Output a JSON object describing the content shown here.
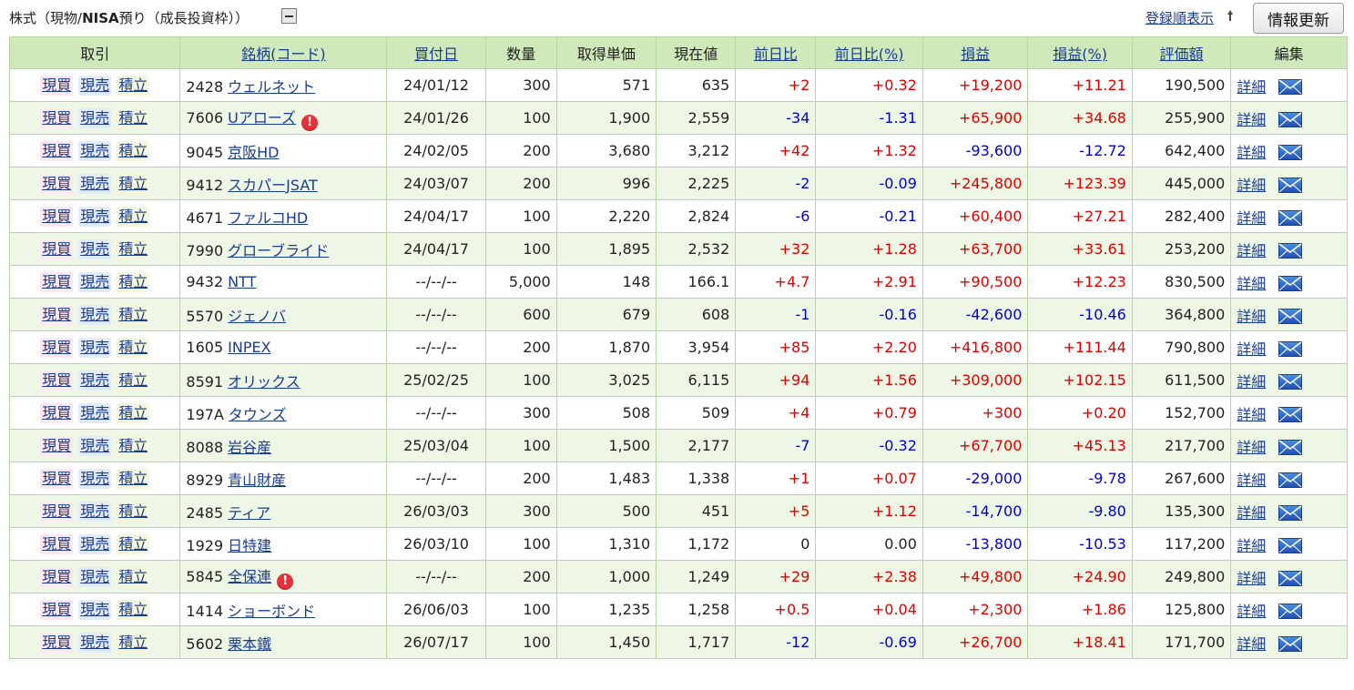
{
  "header": {
    "title_prefix": "株式（現物/",
    "title_bold": "NISA",
    "title_suffix": "預り（成長投資枠））",
    "sort_link": "登録順表示",
    "refresh_button": "情報更新"
  },
  "table": {
    "headers": {
      "trade": "取引",
      "name": "銘柄(コード)",
      "buy_date": "買付日",
      "quantity": "数量",
      "avg_price": "取得単価",
      "current_price": "現在値",
      "change": "前日比",
      "change_pct": "前日比(%)",
      "pl": "損益",
      "pl_pct": "損益(%)",
      "valuation": "評価額",
      "edit": "編集"
    },
    "trade_labels": {
      "buy": "現買",
      "sell": "現売",
      "accum": "積立"
    },
    "detail_label": "詳細",
    "alert_glyph": "!",
    "rows": [
      {
        "code": "2428",
        "name": "ウェルネット",
        "alert": false,
        "date": "24/01/12",
        "qty": "300",
        "avg": "571",
        "price": "635",
        "chg": "+2",
        "chg_pct": "+0.32",
        "pl": "+19,200",
        "pl_pct": "+11.21",
        "val": "190,500"
      },
      {
        "code": "7606",
        "name": "Uアローズ",
        "alert": true,
        "date": "24/01/26",
        "qty": "100",
        "avg": "1,900",
        "price": "2,559",
        "chg": "-34",
        "chg_pct": "-1.31",
        "pl": "+65,900",
        "pl_pct": "+34.68",
        "val": "255,900"
      },
      {
        "code": "9045",
        "name": "京阪HD",
        "alert": false,
        "date": "24/02/05",
        "qty": "200",
        "avg": "3,680",
        "price": "3,212",
        "chg": "+42",
        "chg_pct": "+1.32",
        "pl": "-93,600",
        "pl_pct": "-12.72",
        "val": "642,400"
      },
      {
        "code": "9412",
        "name": "スカパーJSAT",
        "alert": false,
        "date": "24/03/07",
        "qty": "200",
        "avg": "996",
        "price": "2,225",
        "chg": "-2",
        "chg_pct": "-0.09",
        "pl": "+245,800",
        "pl_pct": "+123.39",
        "val": "445,000"
      },
      {
        "code": "4671",
        "name": "ファルコHD",
        "alert": false,
        "date": "24/04/17",
        "qty": "100",
        "avg": "2,220",
        "price": "2,824",
        "chg": "-6",
        "chg_pct": "-0.21",
        "pl": "+60,400",
        "pl_pct": "+27.21",
        "val": "282,400"
      },
      {
        "code": "7990",
        "name": "グローブライド",
        "alert": false,
        "date": "24/04/17",
        "qty": "100",
        "avg": "1,895",
        "price": "2,532",
        "chg": "+32",
        "chg_pct": "+1.28",
        "pl": "+63,700",
        "pl_pct": "+33.61",
        "val": "253,200"
      },
      {
        "code": "9432",
        "name": "NTT",
        "alert": false,
        "date": "--/--/--",
        "qty": "5,000",
        "avg": "148",
        "price": "166.1",
        "chg": "+4.7",
        "chg_pct": "+2.91",
        "pl": "+90,500",
        "pl_pct": "+12.23",
        "val": "830,500"
      },
      {
        "code": "5570",
        "name": "ジェノバ",
        "alert": false,
        "date": "--/--/--",
        "qty": "600",
        "avg": "679",
        "price": "608",
        "chg": "-1",
        "chg_pct": "-0.16",
        "pl": "-42,600",
        "pl_pct": "-10.46",
        "val": "364,800"
      },
      {
        "code": "1605",
        "name": "INPEX",
        "alert": false,
        "date": "--/--/--",
        "qty": "200",
        "avg": "1,870",
        "price": "3,954",
        "chg": "+85",
        "chg_pct": "+2.20",
        "pl": "+416,800",
        "pl_pct": "+111.44",
        "val": "790,800"
      },
      {
        "code": "8591",
        "name": "オリックス",
        "alert": false,
        "date": "25/02/25",
        "qty": "100",
        "avg": "3,025",
        "price": "6,115",
        "chg": "+94",
        "chg_pct": "+1.56",
        "pl": "+309,000",
        "pl_pct": "+102.15",
        "val": "611,500"
      },
      {
        "code": "197A",
        "name": "タウンズ",
        "alert": false,
        "date": "--/--/--",
        "qty": "300",
        "avg": "508",
        "price": "509",
        "chg": "+4",
        "chg_pct": "+0.79",
        "pl": "+300",
        "pl_pct": "+0.20",
        "val": "152,700"
      },
      {
        "code": "8088",
        "name": "岩谷産",
        "alert": false,
        "date": "25/03/04",
        "qty": "100",
        "avg": "1,500",
        "price": "2,177",
        "chg": "-7",
        "chg_pct": "-0.32",
        "pl": "+67,700",
        "pl_pct": "+45.13",
        "val": "217,700"
      },
      {
        "code": "8929",
        "name": "青山財産",
        "alert": false,
        "date": "--/--/--",
        "qty": "200",
        "avg": "1,483",
        "price": "1,338",
        "chg": "+1",
        "chg_pct": "+0.07",
        "pl": "-29,000",
        "pl_pct": "-9.78",
        "val": "267,600"
      },
      {
        "code": "2485",
        "name": "ティア",
        "alert": false,
        "date": "26/03/03",
        "qty": "300",
        "avg": "500",
        "price": "451",
        "chg": "+5",
        "chg_pct": "+1.12",
        "pl": "-14,700",
        "pl_pct": "-9.80",
        "val": "135,300"
      },
      {
        "code": "1929",
        "name": "日特建",
        "alert": false,
        "date": "26/03/10",
        "qty": "100",
        "avg": "1,310",
        "price": "1,172",
        "chg": "0",
        "chg_pct": "0.00",
        "pl": "-13,800",
        "pl_pct": "-10.53",
        "val": "117,200"
      },
      {
        "code": "5845",
        "name": "全保連",
        "alert": true,
        "date": "--/--/--",
        "qty": "200",
        "avg": "1,000",
        "price": "1,249",
        "chg": "+29",
        "chg_pct": "+2.38",
        "pl": "+49,800",
        "pl_pct": "+24.90",
        "val": "249,800"
      },
      {
        "code": "1414",
        "name": "ショーボンド",
        "alert": false,
        "date": "26/06/03",
        "qty": "100",
        "avg": "1,235",
        "price": "1,258",
        "chg": "+0.5",
        "chg_pct": "+0.04",
        "pl": "+2,300",
        "pl_pct": "+1.86",
        "val": "125,800"
      },
      {
        "code": "5602",
        "name": "栗本鐵",
        "alert": false,
        "date": "26/07/17",
        "qty": "100",
        "avg": "1,450",
        "price": "1,717",
        "chg": "-12",
        "chg_pct": "-0.69",
        "pl": "+26,700",
        "pl_pct": "+18.41",
        "val": "171,700"
      }
    ]
  },
  "colors": {
    "header_bg": "#cfe9bb",
    "even_row_bg": "#eef7e6",
    "border": "#b9d5a4",
    "link": "#1a3c8f",
    "positive": "#e00000",
    "negative": "#0000d0",
    "alert": "#e8313b"
  }
}
